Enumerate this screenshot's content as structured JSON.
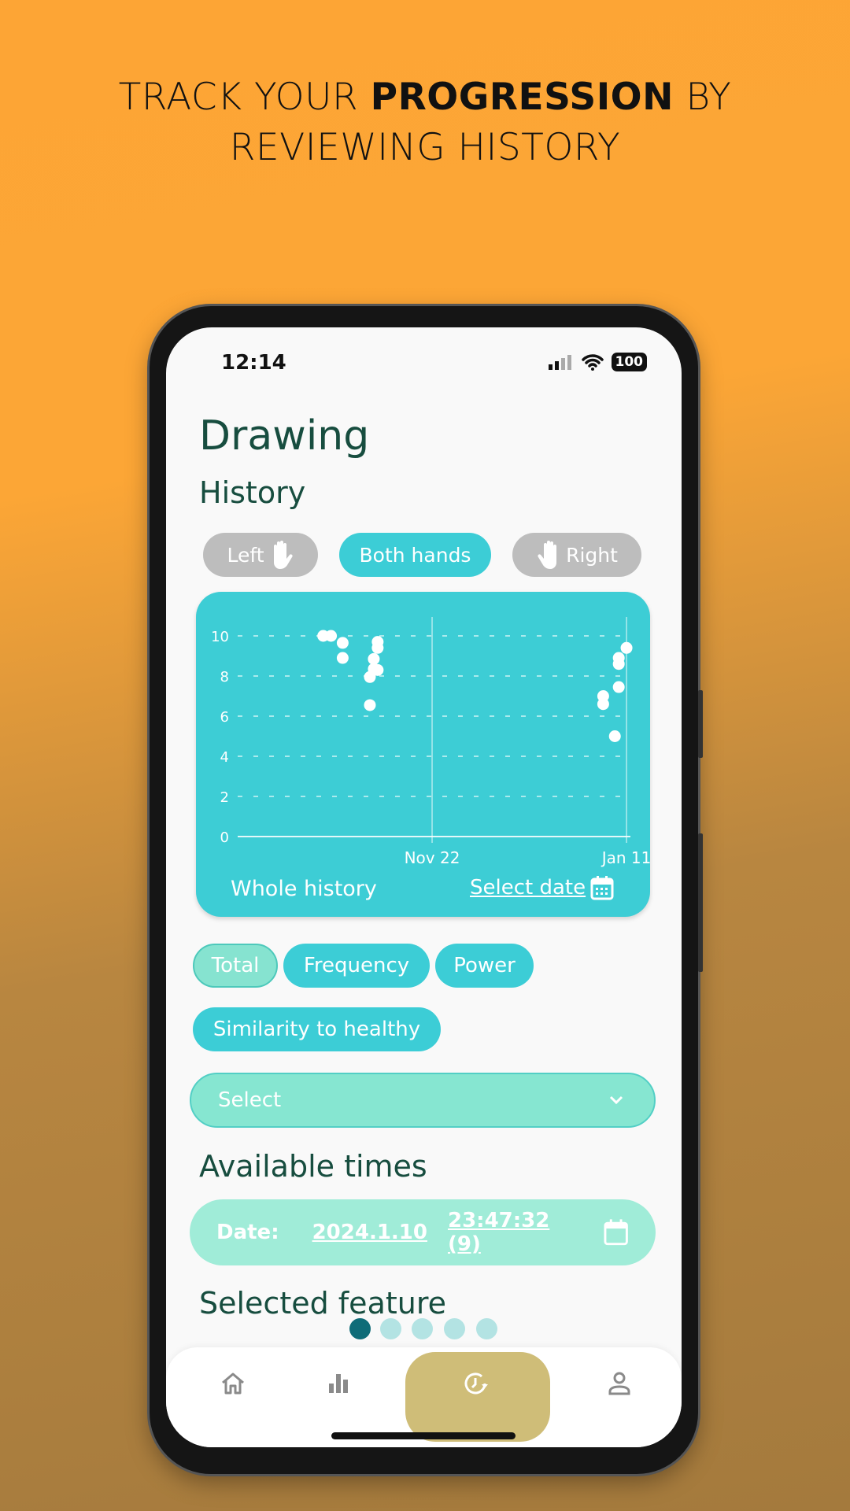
{
  "headline": {
    "pre": "TRACK YOUR ",
    "bold": "PROGRESSION",
    "post": " BY",
    "line2": "REVIEWING HISTORY"
  },
  "status": {
    "time": "12:14",
    "battery": "100",
    "icons": [
      "signal-icon",
      "wifi-icon",
      "battery-icon"
    ]
  },
  "page": {
    "title": "Drawing",
    "subtitle": "History"
  },
  "hand_toggle": [
    {
      "label": "Left",
      "icon": "left-hand-icon",
      "selected": false
    },
    {
      "label": "Both hands",
      "selected": true
    },
    {
      "label": "Right",
      "icon": "right-hand-icon",
      "selected": false
    }
  ],
  "colors": {
    "accent": "#3dcdd5",
    "inactive": "#bdbdbd",
    "text": "#174d3f",
    "nav_active": "#cfbd78",
    "dot_active": "#0f6c78",
    "dot_inactive": "#b3e3e3"
  },
  "chart_card": {
    "whole_history": "Whole history",
    "select_date": "Select date",
    "calendar_icon": "calendar-icon"
  },
  "chart_data": {
    "type": "scatter",
    "ylim": [
      0,
      10
    ],
    "yticks": [
      0,
      2,
      4,
      6,
      8,
      10
    ],
    "xlim": [
      "2023-10-03",
      "2024-01-12"
    ],
    "xticks": [
      {
        "date": "2023-11-22",
        "label": "Nov 22"
      },
      {
        "date": "2024-01-11",
        "label": "Jan 11"
      }
    ],
    "grid": "horizontal dashed",
    "points": [
      {
        "x": "2023-10-25",
        "y": 10
      },
      {
        "x": "2023-10-27",
        "y": 10
      },
      {
        "x": "2023-10-30",
        "y": 9.65
      },
      {
        "x": "2023-10-30",
        "y": 8.9
      },
      {
        "x": "2023-11-06",
        "y": 7.95
      },
      {
        "x": "2023-11-06",
        "y": 6.55
      },
      {
        "x": "2023-11-07",
        "y": 8.85
      },
      {
        "x": "2023-11-07",
        "y": 8.35
      },
      {
        "x": "2023-11-08",
        "y": 9.7
      },
      {
        "x": "2023-11-08",
        "y": 9.4
      },
      {
        "x": "2023-11-08",
        "y": 8.3
      },
      {
        "x": "2024-01-05",
        "y": 7.0
      },
      {
        "x": "2024-01-05",
        "y": 6.6
      },
      {
        "x": "2024-01-08",
        "y": 5.0
      },
      {
        "x": "2024-01-09",
        "y": 8.9
      },
      {
        "x": "2024-01-09",
        "y": 8.6
      },
      {
        "x": "2024-01-09",
        "y": 7.45
      },
      {
        "x": "2024-01-11",
        "y": 9.4
      }
    ]
  },
  "features": [
    {
      "label": "Total",
      "selected": true
    },
    {
      "label": "Frequency",
      "selected": false
    },
    {
      "label": "Power",
      "selected": false
    },
    {
      "label": "Similarity to healthy",
      "selected": false
    }
  ],
  "dropdown": {
    "value": "Select"
  },
  "available": {
    "heading": "Available times",
    "date_label": "Date:",
    "date": "2024.1.10",
    "time": "23:47:32 (9)"
  },
  "selected_feature": {
    "heading": "Selected feature"
  },
  "pager": {
    "count": 5,
    "active": 0
  },
  "nav": [
    {
      "name": "home",
      "active": false
    },
    {
      "name": "stats",
      "active": false
    },
    {
      "name": "history",
      "active": true
    },
    {
      "name": "profile",
      "active": false
    }
  ]
}
